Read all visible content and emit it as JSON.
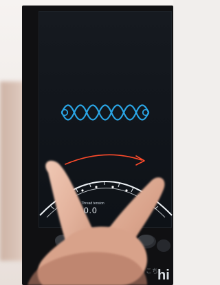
{
  "panel": {
    "label": "Thread tension",
    "value": "0.0"
  },
  "corner_caption": {
    "jp": "こち",
    "latin": "hi"
  },
  "colors": {
    "accent_blue": "#2aa6e6",
    "arrow_red": "#ff4b2b",
    "screen_dark": "#11151b"
  }
}
